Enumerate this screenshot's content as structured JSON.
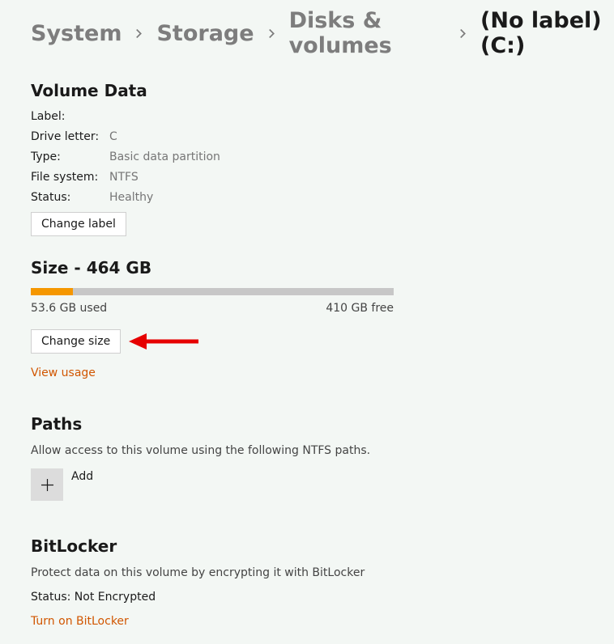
{
  "breadcrumb": {
    "items": [
      "System",
      "Storage",
      "Disks & volumes"
    ],
    "current": "(No label) (C:)"
  },
  "volumeData": {
    "title": "Volume Data",
    "rows": [
      {
        "k": "Label:",
        "v": ""
      },
      {
        "k": "Drive letter:",
        "v": "C"
      },
      {
        "k": "Type:",
        "v": "Basic data partition"
      },
      {
        "k": "File system:",
        "v": "NTFS"
      },
      {
        "k": "Status:",
        "v": "Healthy"
      }
    ],
    "changeLabelBtn": "Change label"
  },
  "size": {
    "title": "Size - 464 GB",
    "usedText": "53.6 GB used",
    "freeText": "410 GB free",
    "percentUsed": 11.55,
    "changeSizeBtn": "Change size",
    "viewUsageLink": "View usage"
  },
  "paths": {
    "title": "Paths",
    "desc": "Allow access to this volume using the following NTFS paths.",
    "addLabel": "Add"
  },
  "bitlocker": {
    "title": "BitLocker",
    "desc": "Protect data on this volume by encrypting it with BitLocker",
    "status": "Status: Not Encrypted",
    "turnOnLink": "Turn on BitLocker"
  },
  "colors": {
    "accent": "#f59700",
    "link": "#d15600",
    "arrow": "#e60000"
  }
}
